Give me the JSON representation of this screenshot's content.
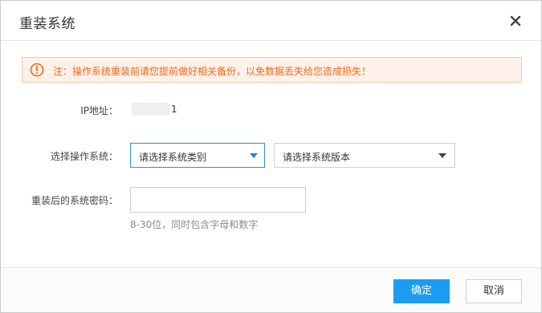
{
  "dialog": {
    "title": "重装系统",
    "close_icon": "close-icon"
  },
  "notice": {
    "icon": "warning-circle-icon",
    "text": "注：操作系统重装前请您提前做好相关备份，以免数据丢失给您造成损失！"
  },
  "form": {
    "ip_label": "IP地址：",
    "ip_value": "1",
    "os_label": "选择操作系统：",
    "os_type_select": "请选择系统类别",
    "os_version_select": "请选择系统版本",
    "password_label": "重装后的系统密码：",
    "password_value": "",
    "password_hint": "8-30位，同时包含字母和数字"
  },
  "footer": {
    "confirm_label": "确定",
    "cancel_label": "取消"
  },
  "colors": {
    "accent": "#1a9df0",
    "notice_bg": "#fdf1e9",
    "notice_text": "#ef6a1c"
  }
}
